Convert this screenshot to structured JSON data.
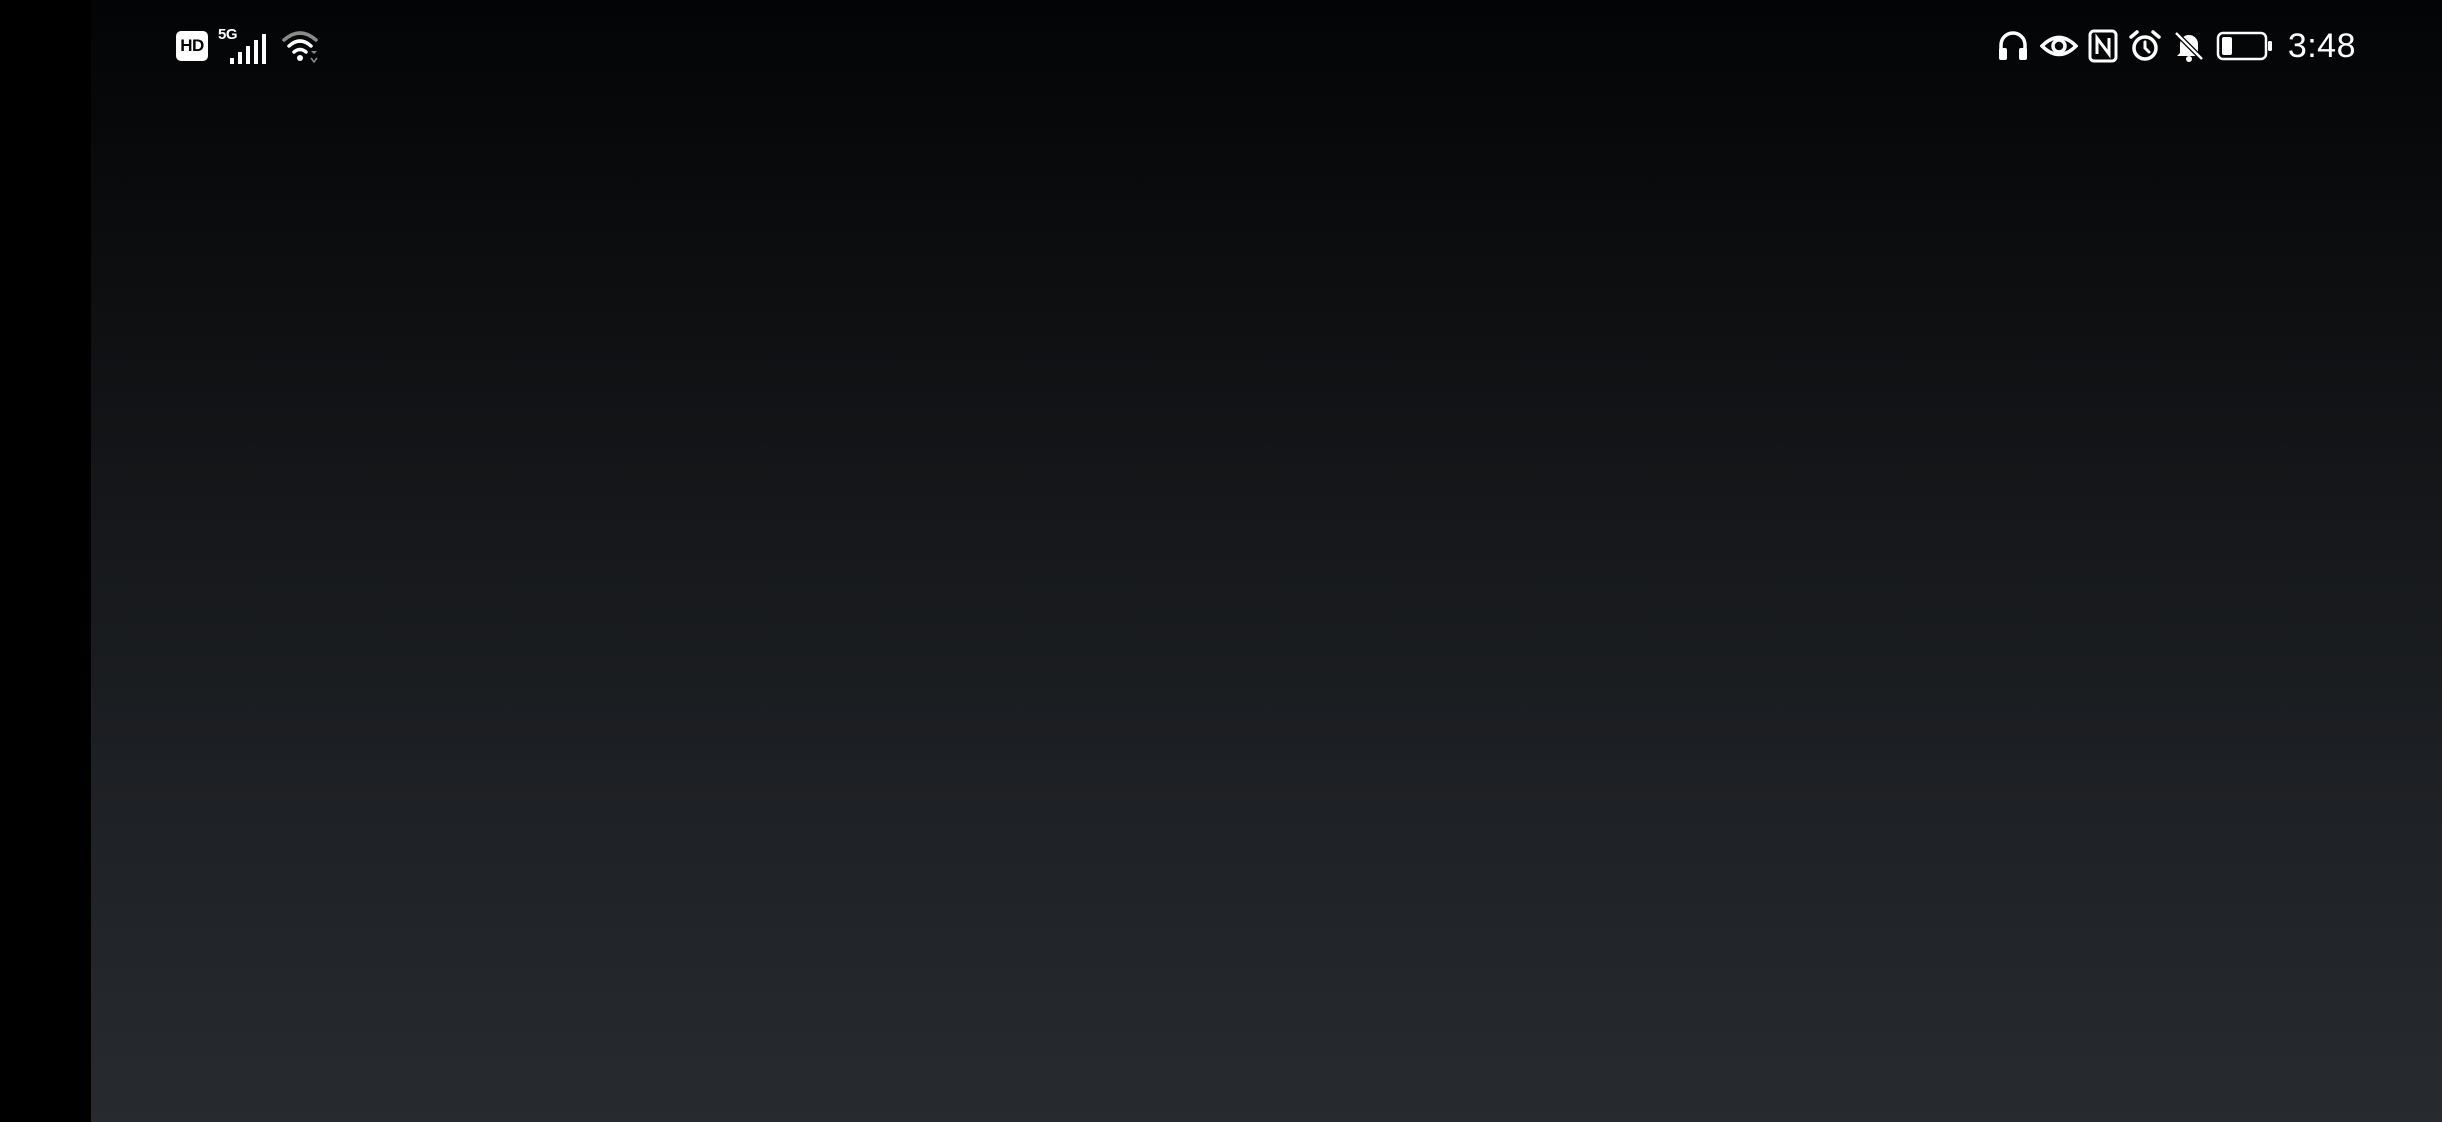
{
  "status_bar": {
    "left_icons": {
      "hd": {
        "label": "HD",
        "icon": "hd-voice-icon"
      },
      "network": {
        "type_label": "5G",
        "icon": "cellular-signal-icon",
        "signal_bars_active": 4,
        "signal_bars_total": 4
      },
      "wifi": {
        "icon": "wifi-icon"
      }
    },
    "right_icons": [
      {
        "icon": "headphones-icon"
      },
      {
        "icon": "eye-comfort-icon"
      },
      {
        "icon": "nfc-icon"
      },
      {
        "icon": "alarm-icon"
      },
      {
        "icon": "notifications-muted-icon"
      },
      {
        "icon": "battery-icon",
        "level_fraction": 0.25
      }
    ],
    "time": "3:48"
  },
  "colors": {
    "status_text": "#ffffff",
    "gradient_top": "#030405",
    "gradient_bottom": "#272b30",
    "gutter": "#000000"
  }
}
